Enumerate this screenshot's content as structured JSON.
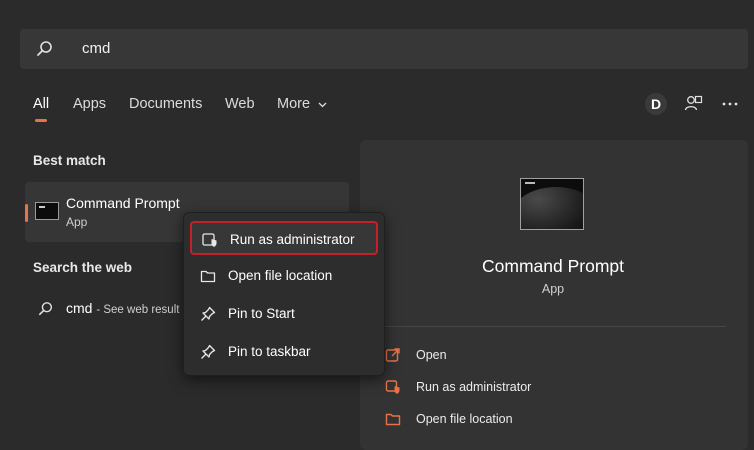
{
  "search": {
    "value": "cmd"
  },
  "tabs": [
    {
      "label": "All",
      "active": true
    },
    {
      "label": "Apps"
    },
    {
      "label": "Documents"
    },
    {
      "label": "Web"
    },
    {
      "label": "More"
    }
  ],
  "header": {
    "avatar_letter": "D"
  },
  "best_match": {
    "section_title": "Best match",
    "title": "Command Prompt",
    "subtitle": "App"
  },
  "search_web": {
    "section_title": "Search the web",
    "query": "cmd",
    "suffix": "- See web result"
  },
  "context_menu": {
    "items": [
      {
        "label": "Run as administrator",
        "icon": "shield-icon",
        "highlighted": true
      },
      {
        "label": "Open file location",
        "icon": "folder-icon"
      },
      {
        "label": "Pin to Start",
        "icon": "pin-icon"
      },
      {
        "label": "Pin to taskbar",
        "icon": "pin-icon"
      }
    ]
  },
  "details": {
    "title": "Command Prompt",
    "subtitle": "App",
    "actions": [
      {
        "label": "Open",
        "icon": "open-external-icon"
      },
      {
        "label": "Run as administrator",
        "icon": "shield-icon"
      },
      {
        "label": "Open file location",
        "icon": "folder-icon"
      }
    ]
  },
  "colors": {
    "accent": "#e8734a",
    "highlight_border": "#c4202a",
    "background": "#2b2b2b"
  }
}
